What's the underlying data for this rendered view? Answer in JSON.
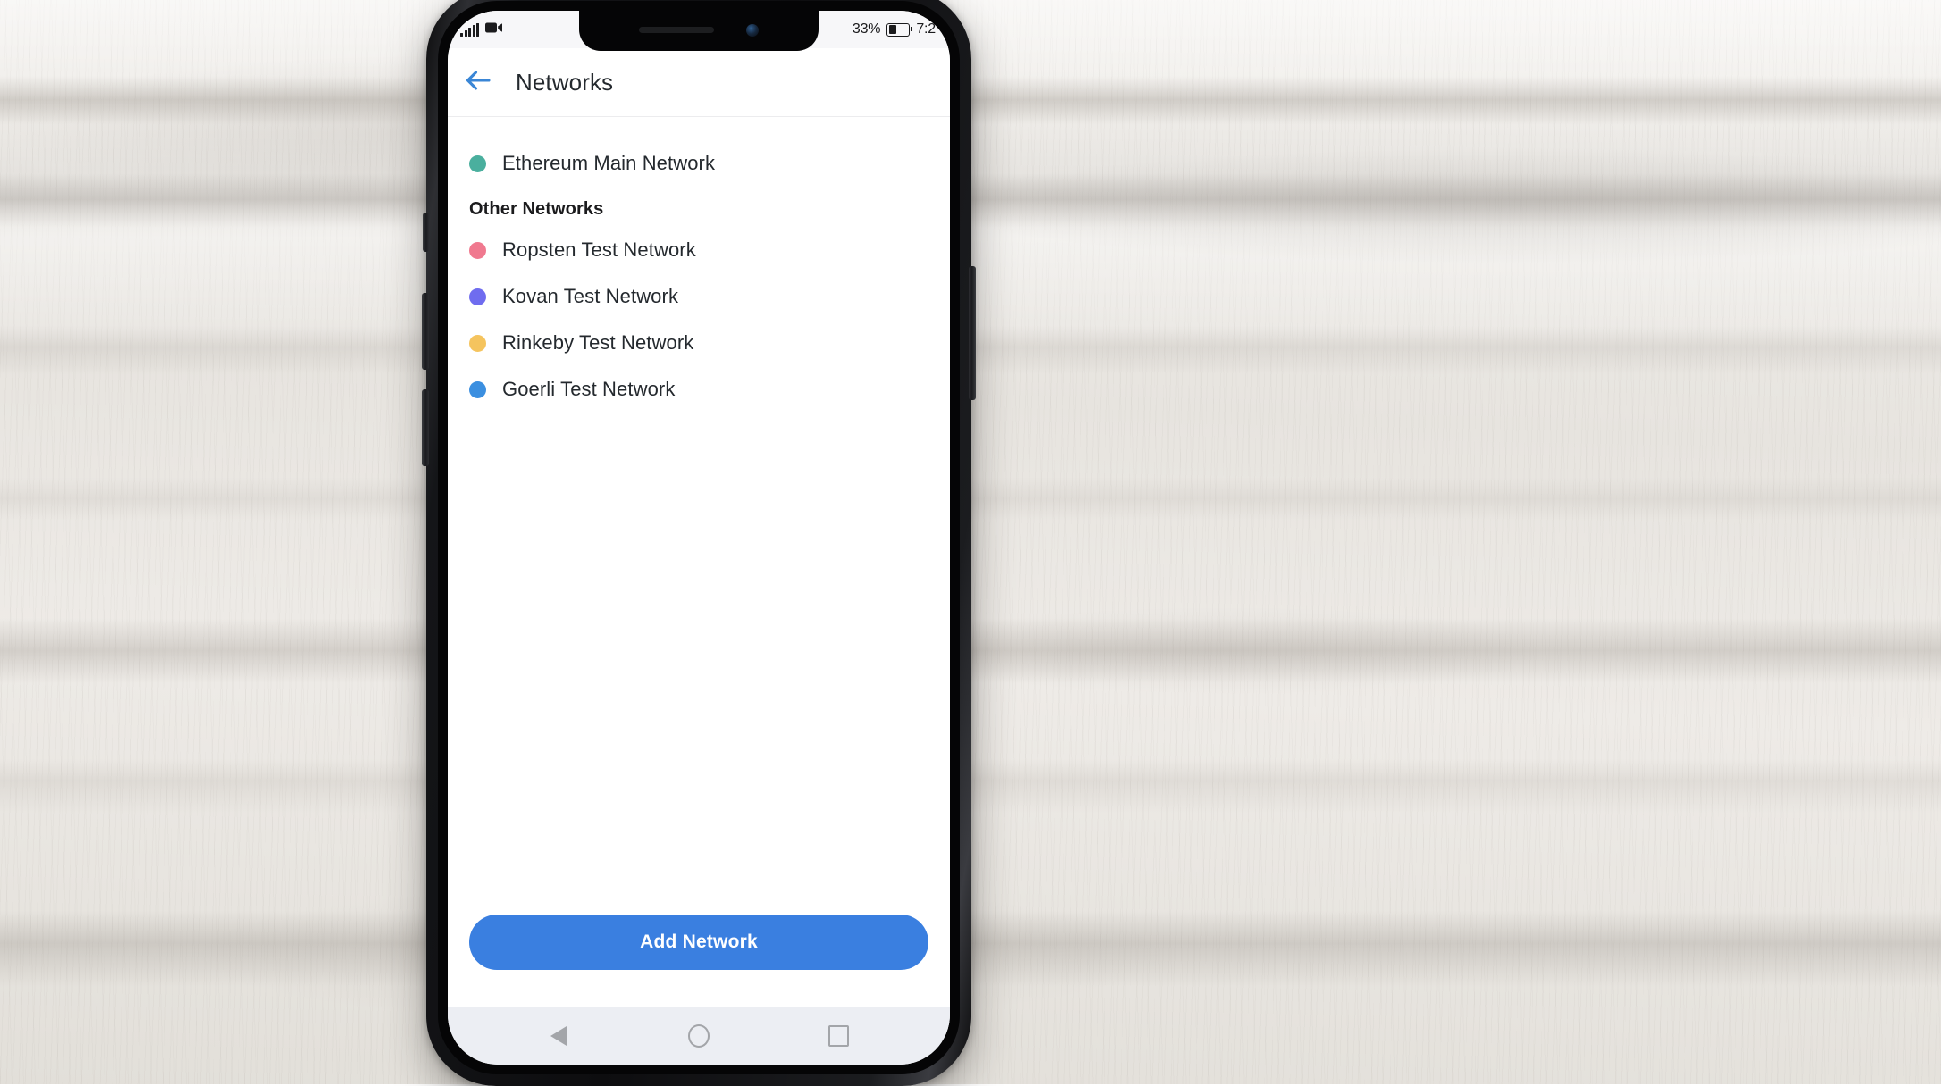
{
  "status_bar": {
    "signal_icon": "signal-bars-icon",
    "recording_icon": "video-camera-icon",
    "battery_percent": "33%",
    "battery_level": 33,
    "time": "7:2"
  },
  "header": {
    "back_icon": "arrow-left-icon",
    "title": "Networks"
  },
  "networks": {
    "primary": [
      {
        "label": "Ethereum Main Network",
        "color": "#4aaf9e"
      }
    ],
    "other_header": "Other Networks",
    "other": [
      {
        "label": "Ropsten Test Network",
        "color": "#f0798f"
      },
      {
        "label": "Kovan Test Network",
        "color": "#6f6cef"
      },
      {
        "label": "Rinkeby Test Network",
        "color": "#f5c martin"
      },
      {
        "label": "Goerli Test Network",
        "color": "#3b8fe0"
      }
    ]
  },
  "footer": {
    "add_network_label": "Add Network",
    "accent_color": "#3a7fe0"
  },
  "android_nav": {
    "back_icon": "triangle-back-icon",
    "home_icon": "circle-home-icon",
    "recents_icon": "square-recents-icon"
  }
}
